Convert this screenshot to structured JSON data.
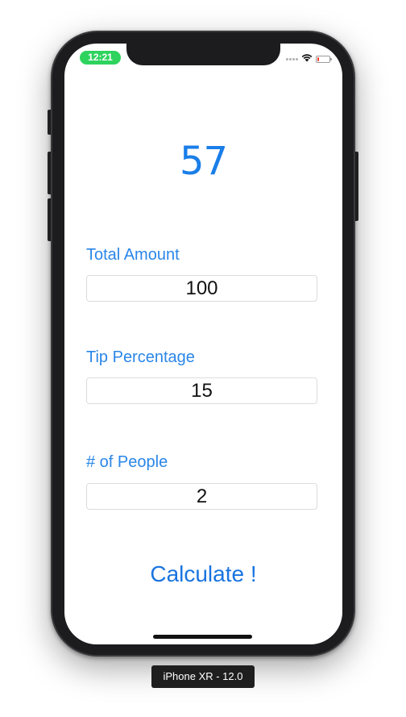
{
  "status_bar": {
    "time": "12:21",
    "icons": [
      "signal-icon",
      "wifi-icon",
      "battery-icon"
    ],
    "battery_color": "#ff3b30",
    "time_pill_color": "#2dd35d"
  },
  "result": {
    "value": "57"
  },
  "form": {
    "total_amount": {
      "label": "Total Amount",
      "value": "100"
    },
    "tip_percentage": {
      "label": "Tip Percentage",
      "value": "15"
    },
    "people": {
      "label": "# of People",
      "value": "2"
    }
  },
  "actions": {
    "calculate_label": "Calculate !"
  },
  "colors": {
    "accent": "#1a7ee8",
    "label": "#2a86e8"
  },
  "device": {
    "caption": "iPhone XR - 12.0"
  }
}
